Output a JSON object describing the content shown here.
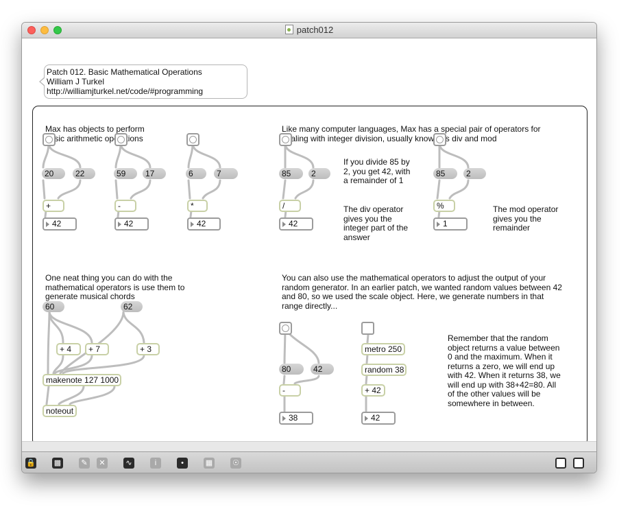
{
  "window": {
    "title": "patch012"
  },
  "header_comment": {
    "line1": "Patch 012. Basic Mathematical Operations",
    "line2": "William J Turkel",
    "line3": "http://williamjturkel.net/code/#programming"
  },
  "arith": {
    "intro": [
      "Max has objects to perform",
      "basic arithmetic operations"
    ],
    "add": {
      "left": "20",
      "right": "22",
      "op": "+",
      "result": "42"
    },
    "sub": {
      "left": "59",
      "right": "17",
      "op": "-",
      "result": "42"
    },
    "mul": {
      "left": "6",
      "right": "7",
      "op": "*",
      "result": "42"
    }
  },
  "intdiv": {
    "intro": [
      "Like many computer languages, Max has a special pair of operators for",
      "dealing with integer division, usually known as div and mod"
    ],
    "divide_note": [
      "If you divide 85 by",
      "2, you get 42, with",
      "a remainder of 1"
    ],
    "div": {
      "left": "85",
      "right": "2",
      "op": "/",
      "result": "42",
      "note": [
        "The div operator",
        "gives you the",
        "integer part of the",
        "answer"
      ]
    },
    "mod": {
      "left": "85",
      "right": "2",
      "op": "%",
      "result": "1",
      "note": [
        "The mod operator",
        "gives you the",
        "remainder"
      ]
    }
  },
  "chords": {
    "intro": [
      "One neat thing you can do with the",
      "mathematical operators is use them to",
      "generate musical chords"
    ],
    "msg_a": "60",
    "msg_b": "62",
    "plus4": "+ 4",
    "plus7": "+ 7",
    "plus3": "+ 3",
    "makenote": "makenote 127 1000",
    "noteout": "noteout"
  },
  "random": {
    "intro": [
      "You can also use the mathematical operators to adjust the output of your",
      "random generator. In an earlier patch, we wanted random values between 42",
      "and 80, so we used the scale object. Here, we generate numbers in that",
      "range directly..."
    ],
    "msg_80": "80",
    "msg_42": "42",
    "sub_op": "-",
    "sub_result": "38",
    "metro": "metro 250",
    "random_obj": "random 38",
    "plus42": "+ 42",
    "plus_result": "42",
    "note": [
      "Remember that the random",
      "object returns a value between",
      "0 and the maximum. When it",
      "returns a zero, we will end up",
      "with 42. When it returns 38, we",
      "will end up with 38+42=80. All",
      "of the other values will be",
      "somewhere in between."
    ]
  },
  "colors": {
    "cord": "#bdbdbd",
    "object_border": "#c8d0a6",
    "message_fill": "#c9c9c9"
  },
  "toolbar_icons": [
    "lock-icon",
    "presentation-icon",
    "edit-icon",
    "close-icon",
    "debug-icon",
    "inspector-icon",
    "connect-icon",
    "grid-icon",
    "clue-icon",
    "left-panel-icon",
    "right-panel-icon"
  ]
}
